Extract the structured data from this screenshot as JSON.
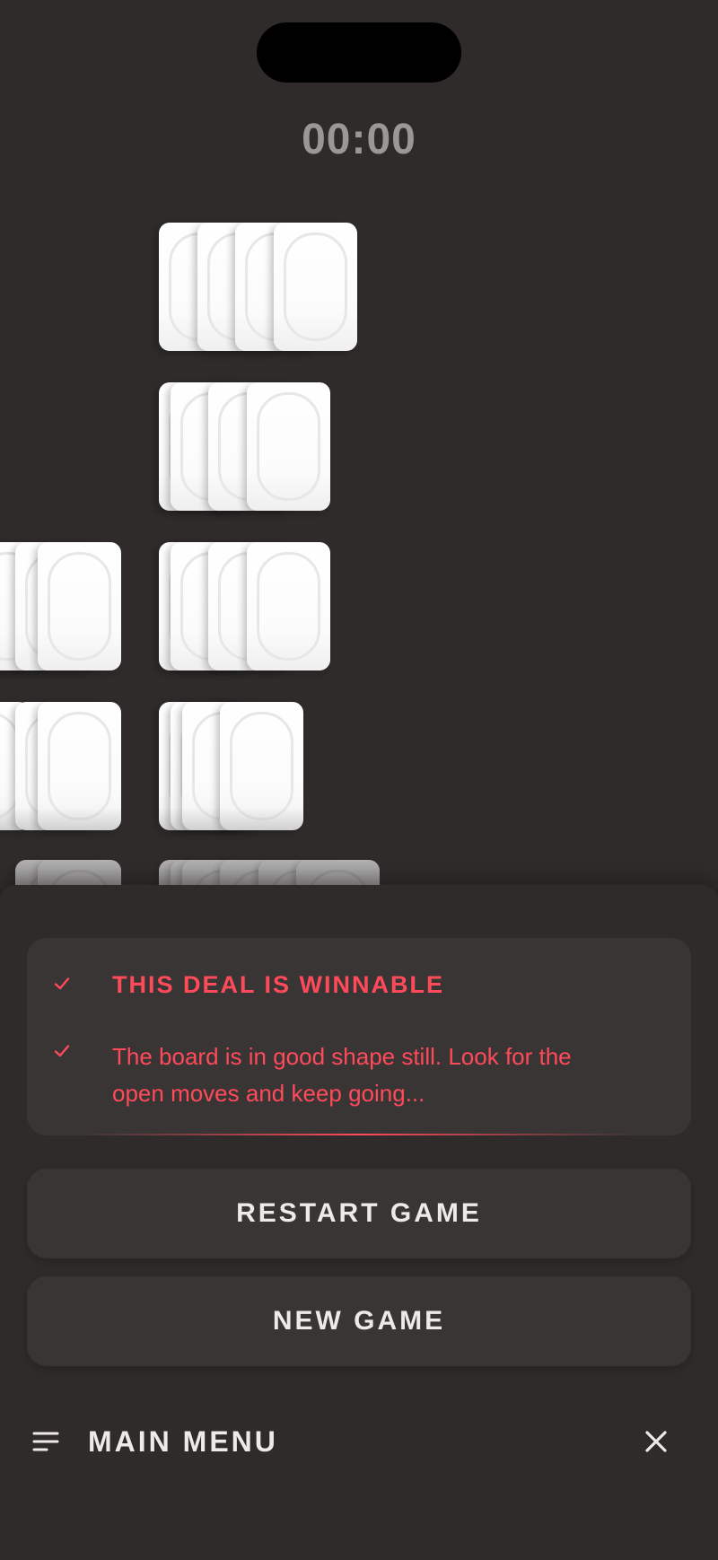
{
  "timer": "00:00",
  "status": {
    "heading": "THIS DEAL IS WINNABLE",
    "body_line1": "The board is in good shape still. Look for the",
    "body_line2": "open moves and keep going...",
    "accent_color": "#ff4a5a",
    "icons": [
      "check-icon",
      "check-icon"
    ]
  },
  "actions": {
    "restart_label": "RESTART GAME",
    "new_game_label": "NEW GAME"
  },
  "menu": {
    "label": "MAIN MENU",
    "left_icon": "menu-lines-icon",
    "right_icon": "close-icon"
  },
  "colors": {
    "background": "#2f2b2b",
    "panel": "#393535",
    "card": "#ffffff",
    "button_text": "#efeaea",
    "timer_text": "#9a9797"
  }
}
